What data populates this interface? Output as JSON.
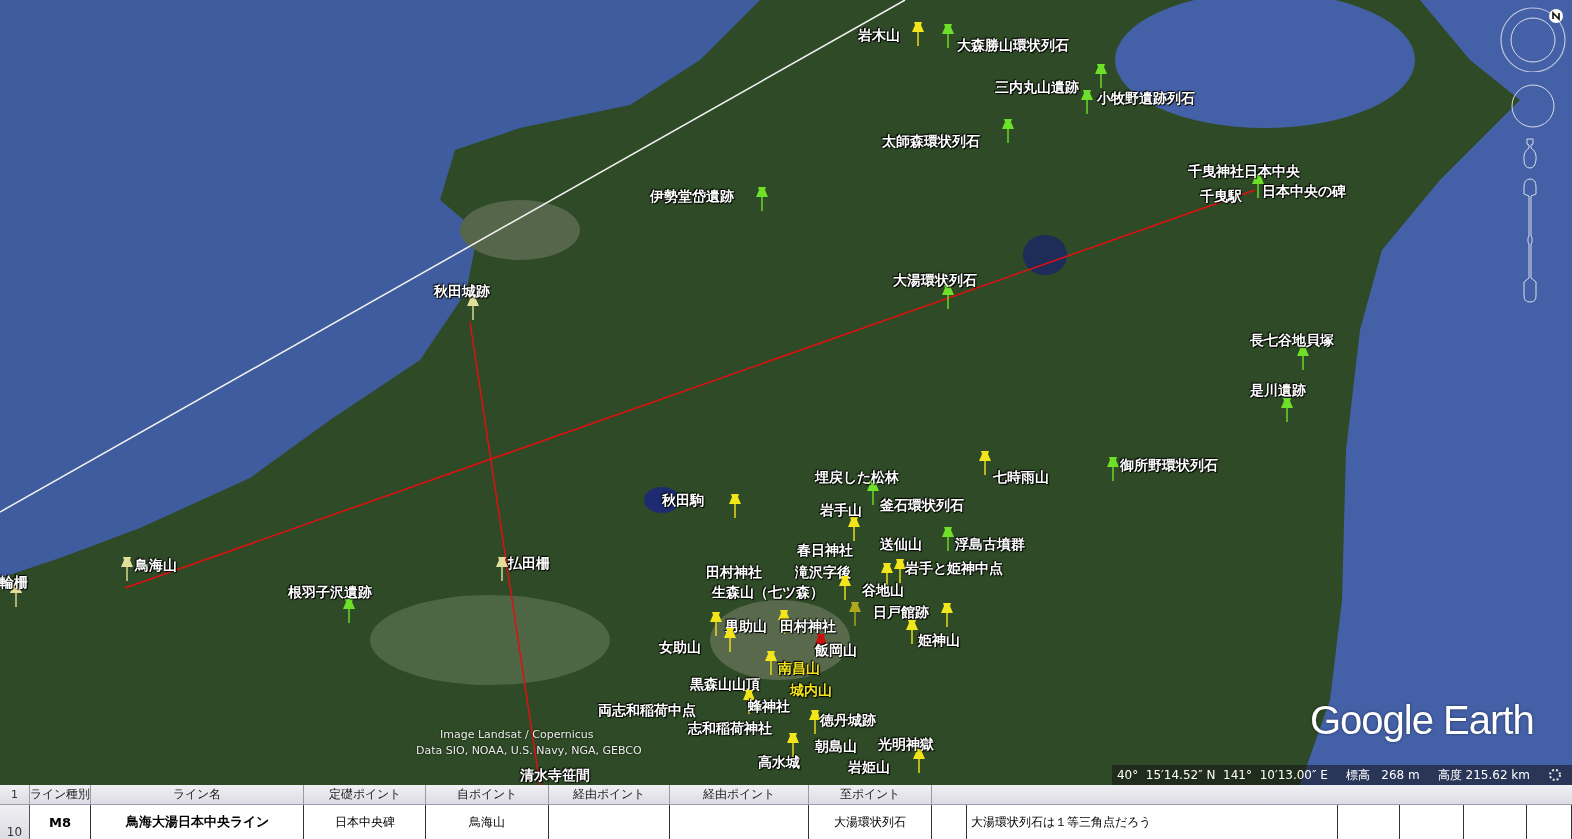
{
  "map": {
    "placemarks": [
      {
        "label": "岩木山",
        "color": "#f2e51a",
        "highlighted": false
      },
      {
        "label": "大森勝山環状列石",
        "color": "#6ee02a",
        "highlighted": false
      },
      {
        "label": "三内丸山遺跡",
        "color": "#6ee02a",
        "highlighted": false
      },
      {
        "label": "小牧野遺跡列石",
        "color": "#6ee02a",
        "highlighted": false
      },
      {
        "label": "太師森環状列石",
        "color": "#6ee02a",
        "highlighted": false
      },
      {
        "label": "伊勢堂岱遺跡",
        "color": "#6ee02a",
        "highlighted": false
      },
      {
        "label": "千曳神社日本中央",
        "color": "#6ee02a",
        "highlighted": false
      },
      {
        "label": "千曳駅",
        "highlighted": false
      },
      {
        "label": "日本中央の碑",
        "highlighted": false
      },
      {
        "label": "大湯環状列石",
        "color": "#6ee02a",
        "highlighted": false
      },
      {
        "label": "秋田城跡",
        "color": "#e3df9a",
        "highlighted": false
      },
      {
        "label": "長七谷地貝塚",
        "color": "#6ee02a",
        "highlighted": false
      },
      {
        "label": "是川遺跡",
        "color": "#6ee02a",
        "highlighted": false
      },
      {
        "label": "埋戻した松林",
        "color": "#6ee02a",
        "highlighted": false
      },
      {
        "label": "七時雨山",
        "color": "#f2e51a",
        "highlighted": false
      },
      {
        "label": "御所野環状列石",
        "color": "#6ee02a",
        "highlighted": false
      },
      {
        "label": "秋田駒",
        "color": "#f2e51a",
        "highlighted": false
      },
      {
        "label": "岩手山",
        "color": "#f2e51a",
        "highlighted": false
      },
      {
        "label": "釜石環状列石",
        "highlighted": false
      },
      {
        "label": "春日神社",
        "highlighted": false
      },
      {
        "label": "送仙山",
        "highlighted": false
      },
      {
        "label": "浮島古墳群",
        "color": "#6ee02a",
        "highlighted": false
      },
      {
        "label": "田村神社",
        "highlighted": false
      },
      {
        "label": "滝沢字後",
        "color": "#f2e51a",
        "highlighted": false
      },
      {
        "label": "岩手と姫神中点",
        "color": "#f2e51a",
        "highlighted": false
      },
      {
        "label": "生森山（七ツ森）",
        "color": "#f2e51a",
        "highlighted": false
      },
      {
        "label": "谷地山",
        "color": "#b0a820",
        "highlighted": false
      },
      {
        "label": "日戸館跡",
        "color": "#f2e51a",
        "highlighted": false
      },
      {
        "label": "男助山",
        "color": "#f2e51a",
        "highlighted": false
      },
      {
        "label": "田村神社",
        "color": "#f2e51a",
        "highlighted": false
      },
      {
        "label": "姫神山",
        "color": "#f2e51a",
        "highlighted": false
      },
      {
        "label": "女助山",
        "color": "#f2e51a",
        "highlighted": false
      },
      {
        "label": "飯岡山",
        "color": "#cc1010",
        "highlighted": false
      },
      {
        "label": "南昌山",
        "color": "#f2e51a",
        "highlighted": true
      },
      {
        "label": "黒森山山頂",
        "highlighted": false
      },
      {
        "label": "城内山",
        "highlighted": true
      },
      {
        "label": "両志和稲荷中点",
        "color": "#f2e51a",
        "highlighted": false
      },
      {
        "label": "蜂神社",
        "highlighted": false
      },
      {
        "label": "志和稲荷神社",
        "color": "#f2e51a",
        "highlighted": false
      },
      {
        "label": "徳丹城跡",
        "color": "#f2e51a",
        "highlighted": false
      },
      {
        "label": "朝島山",
        "highlighted": false
      },
      {
        "label": "光明神獄",
        "color": "#f2e51a",
        "highlighted": false
      },
      {
        "label": "高水城",
        "highlighted": false
      },
      {
        "label": "岩姫山",
        "highlighted": false
      },
      {
        "label": "清水寺笹間",
        "highlighted": false
      },
      {
        "label": "鳥海山",
        "color": "#e3df9a",
        "highlighted": false
      },
      {
        "label": "払田柵",
        "color": "#e3df9a",
        "highlighted": false
      },
      {
        "label": "根羽子沢遺跡",
        "color": "#6ee02a",
        "highlighted": false
      },
      {
        "label": "輪柵",
        "color": "#e3df9a",
        "highlighted": false
      }
    ],
    "attribution": [
      "Image Landsat / Copernicus",
      "Data SIO, NOAA, U.S. Navy, NGA, GEBCO"
    ],
    "logo": "Google Earth",
    "status_bar": {
      "coordinates": "40°  15′14.52″ N  141°  10′13.00″ E",
      "elevation": "標高   268 m",
      "altitude": "高度 215.62 km"
    }
  },
  "table": {
    "row_header": "1",
    "columns": [
      "ライン種別",
      "ライン名",
      "定礎ポイント",
      "自ポイント",
      "経由ポイント",
      "経由ポイント",
      "至ポイント"
    ],
    "rows": [
      {
        "row_number": "10",
        "cells": [
          "M8",
          "鳥海大湯日本中央ライン",
          "日本中央碑",
          "鳥海山",
          null,
          null,
          "大湯環状列石",
          null,
          "大湯環状列石は１等三角点だろう",
          null,
          null,
          null,
          null
        ]
      }
    ]
  }
}
